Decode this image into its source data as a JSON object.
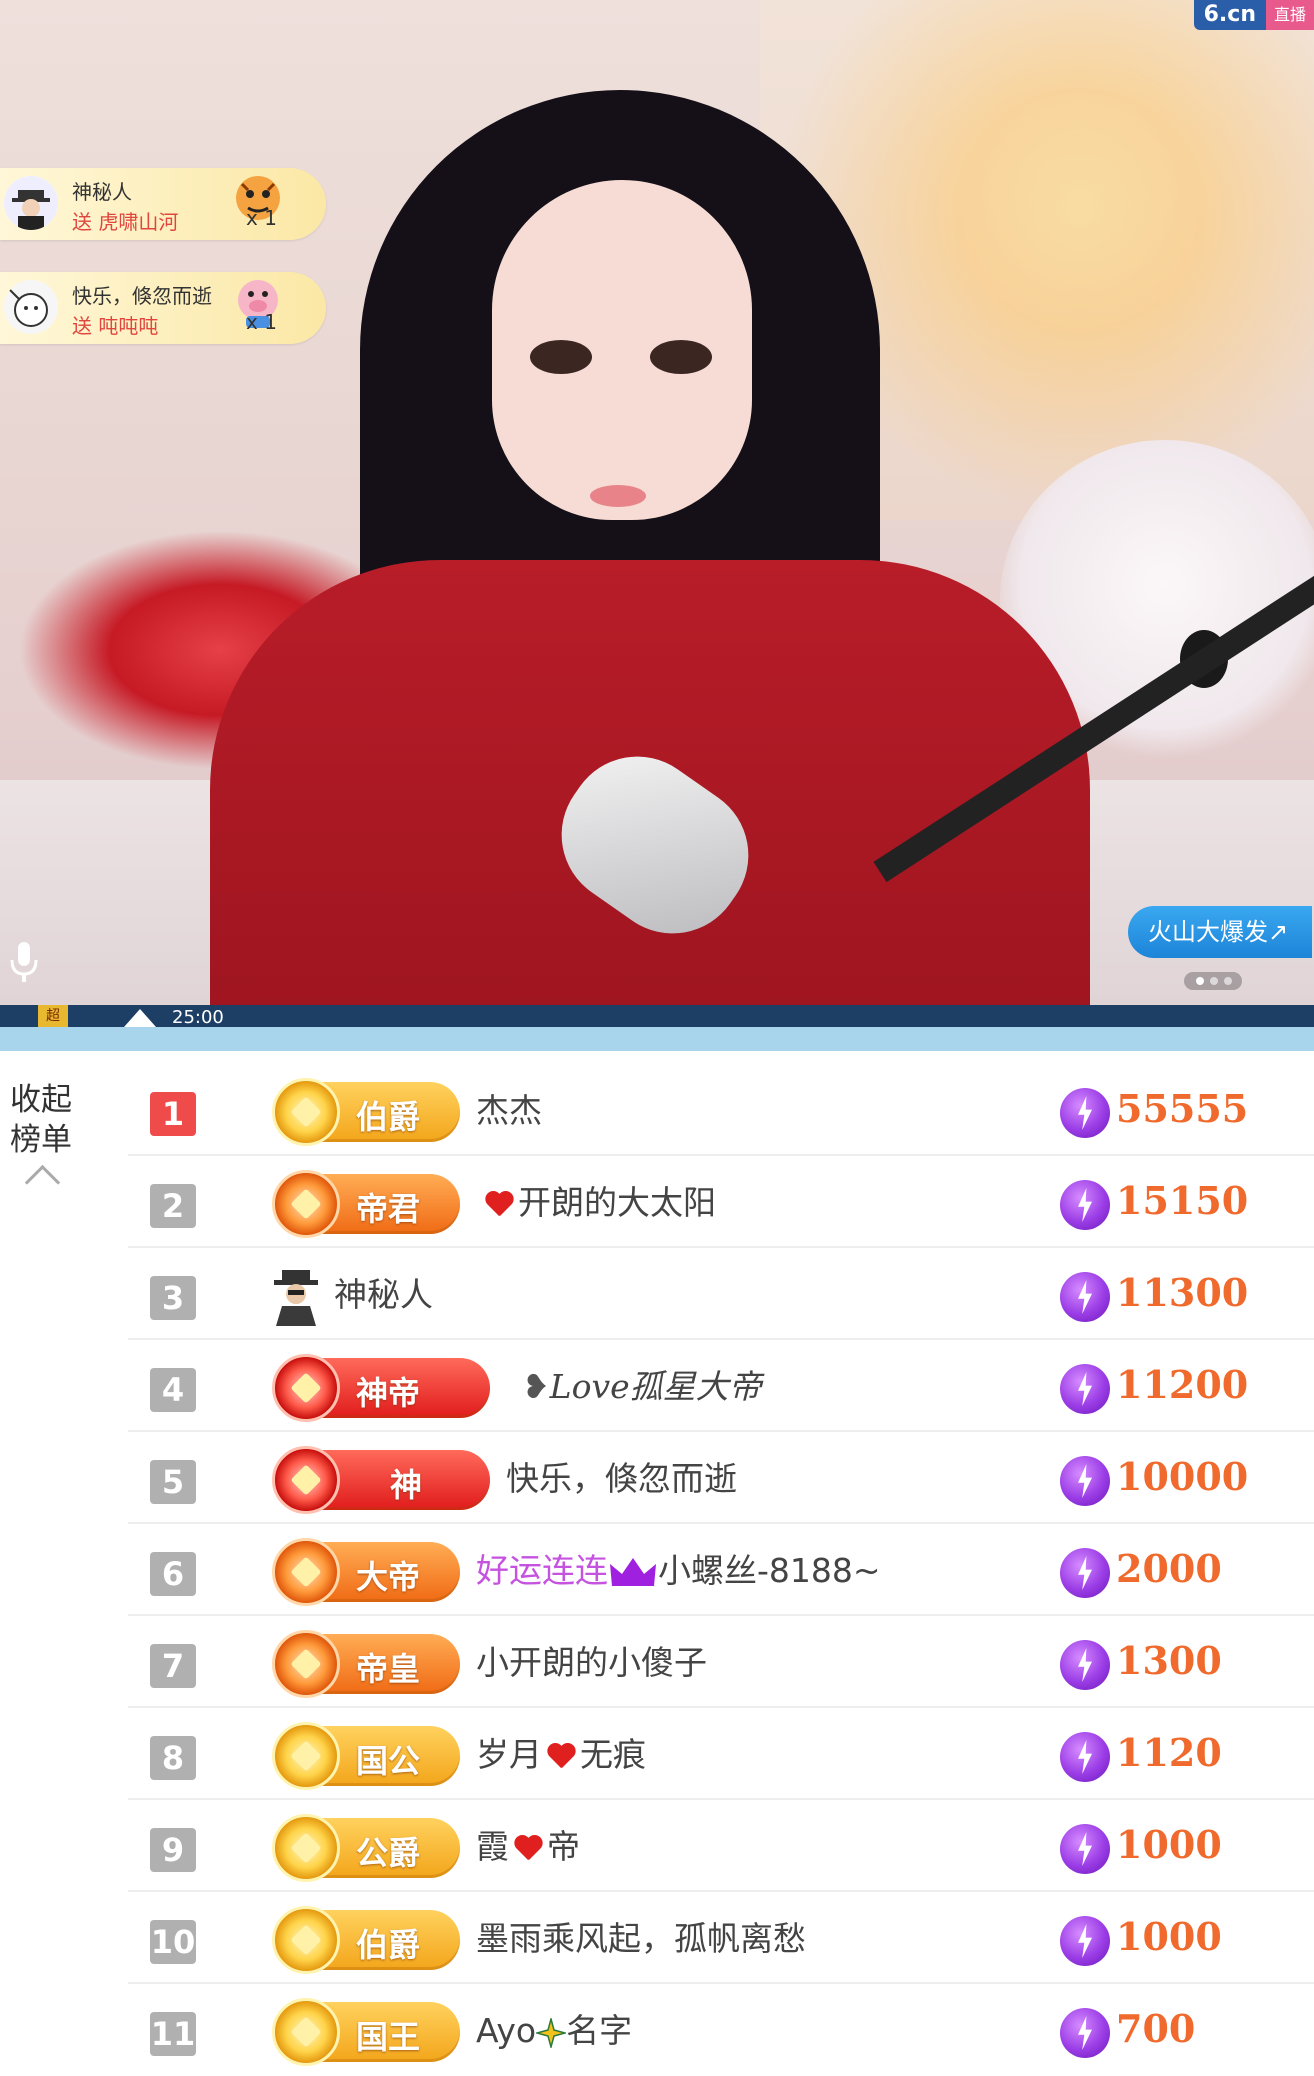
{
  "brand": {
    "logo": "6.cn",
    "tag": "直播"
  },
  "gifts": [
    {
      "name": "神秘人",
      "line": "送 虎啸山河",
      "count": "x 1"
    },
    {
      "name": "快乐，倏忽而逝",
      "line": "送 吨吨吨",
      "count": "x 1"
    }
  ],
  "volcano_button": "火山大爆发↗",
  "video_bar": {
    "level": "超",
    "time": "25:00"
  },
  "collapse": {
    "line1": "收起",
    "line2": "榜单"
  },
  "ranking": [
    {
      "rank": "1",
      "title": "伯爵",
      "name": "杰杰",
      "score": "55555"
    },
    {
      "rank": "2",
      "title": "帝君",
      "name": "开朗的大太阳",
      "score": "15150"
    },
    {
      "rank": "3",
      "title": "",
      "name": "神秘人",
      "score": "11300"
    },
    {
      "rank": "4",
      "title": "神帝",
      "name": "Love孤星大帝",
      "score": "11200"
    },
    {
      "rank": "5",
      "title": "神",
      "name": "快乐，倏忽而逝",
      "score": "10000"
    },
    {
      "rank": "6",
      "title": "大帝",
      "name_prefix": "好运连连",
      "name": "小螺丝-8188~",
      "score": "2000"
    },
    {
      "rank": "7",
      "title": "帝皇",
      "name": "小开朗的小傻子",
      "score": "1300"
    },
    {
      "rank": "8",
      "title": "国公",
      "name_a": "岁月",
      "name_b": "无痕",
      "score": "1120"
    },
    {
      "rank": "9",
      "title": "公爵",
      "name_a": "霞",
      "name_b": "帝",
      "score": "1000"
    },
    {
      "rank": "10",
      "title": "伯爵",
      "name": "墨雨乘风起，孤帆离愁",
      "score": "1000"
    },
    {
      "rank": "11",
      "title": "国王",
      "name_a": "Ayo",
      "name_b": "名字",
      "score": "700"
    }
  ],
  "colors": {
    "accent_blue": "#1d84d8",
    "score_orange": "#ef6a2c",
    "coin_purple": "#9b3de6",
    "rank_red": "#ef4b4b"
  }
}
